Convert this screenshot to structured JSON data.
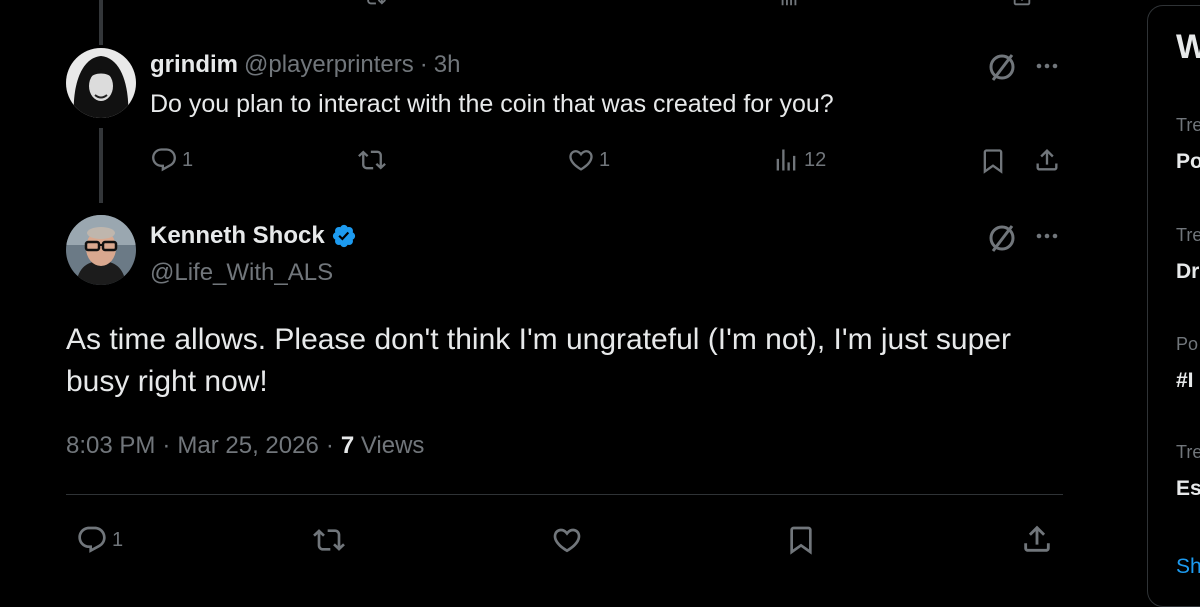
{
  "reply": {
    "display_name": "grindim",
    "handle": "@playerprinters",
    "separator": "·",
    "time": "3h",
    "text": "Do you plan to interact with the coin that was created for you?",
    "reply_count": "1",
    "like_count": "1",
    "view_count": "12"
  },
  "main_post": {
    "display_name": "Kenneth Shock",
    "handle": "@Life_With_ALS",
    "text": "As time allows. Please don't think I'm ungrateful (I'm not), I'm just super busy right now!",
    "time": "8:03 PM",
    "date": "Mar 25, 2026",
    "separator1": "·",
    "separator2": "·",
    "views_count": "7",
    "views_label": "Views",
    "reply_count": "1"
  },
  "sidebar": {
    "heading": "W",
    "items": [
      {
        "meta": "Tre",
        "title": "Po"
      },
      {
        "meta": "Tre",
        "title": "Dr"
      },
      {
        "meta": "Po",
        "title": "#I"
      },
      {
        "meta": "Tre",
        "title": "Es"
      }
    ],
    "show_more": "Sh"
  },
  "colors": {
    "background": "#000000",
    "text": "#e7e9ea",
    "muted": "#71767b",
    "divider": "#2f3336",
    "verified": "#1d9bf0",
    "link": "#1d9bf0"
  },
  "icons": [
    "reply-icon",
    "retweet-icon",
    "like-icon",
    "views-icon",
    "bookmark-icon",
    "share-icon",
    "grok-icon",
    "more-icon",
    "verified-badge-icon"
  ]
}
